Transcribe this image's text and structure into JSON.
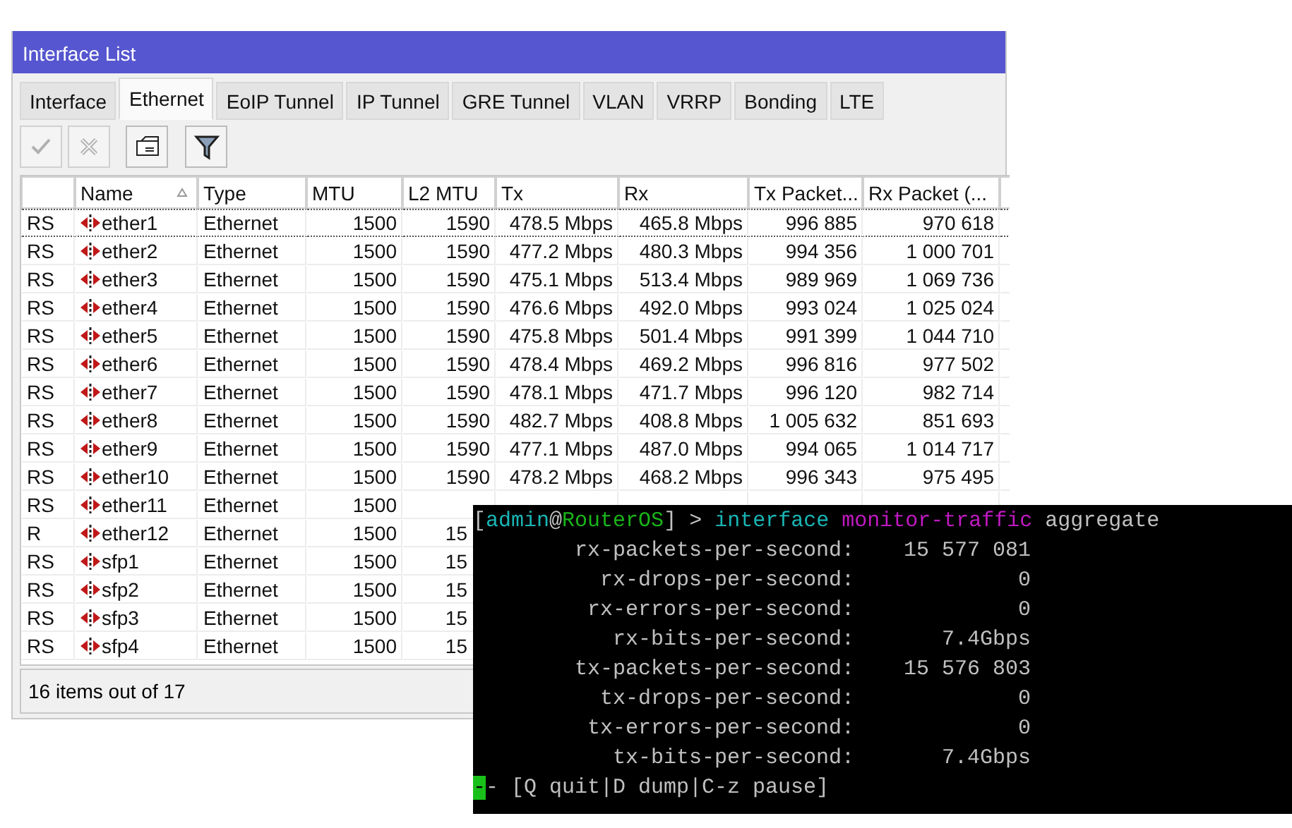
{
  "window": {
    "title": "Interface List"
  },
  "tabs": [
    {
      "label": "Interface",
      "selected": false
    },
    {
      "label": "Ethernet",
      "selected": true
    },
    {
      "label": "EoIP Tunnel",
      "selected": false
    },
    {
      "label": "IP Tunnel",
      "selected": false
    },
    {
      "label": "GRE Tunnel",
      "selected": false
    },
    {
      "label": "VLAN",
      "selected": false
    },
    {
      "label": "VRRP",
      "selected": false
    },
    {
      "label": "Bonding",
      "selected": false
    },
    {
      "label": "LTE",
      "selected": false
    }
  ],
  "toolbar": [
    {
      "kind": "enable",
      "disabled": true
    },
    {
      "kind": "disable",
      "disabled": true
    },
    {
      "kind": "comment",
      "disabled": false
    },
    {
      "kind": "filter",
      "disabled": false
    }
  ],
  "table": {
    "columns": [
      {
        "label": "Name",
        "sorted": true
      },
      {
        "label": "Type",
        "sorted": false
      },
      {
        "label": "MTU",
        "sorted": false
      },
      {
        "label": "L2 MTU",
        "sorted": false
      },
      {
        "label": "Tx",
        "sorted": false
      },
      {
        "label": "Rx",
        "sorted": false
      },
      {
        "label": "Tx Packet...",
        "sorted": false
      },
      {
        "label": "Rx Packet (...",
        "sorted": false
      }
    ],
    "rows": [
      {
        "flags": "RS",
        "selected": true,
        "cells": [
          "ether1",
          "Ethernet",
          "1500",
          "1590",
          "478.5 Mbps",
          "465.8 Mbps",
          "996 885",
          "970 618"
        ]
      },
      {
        "flags": "RS",
        "selected": false,
        "cells": [
          "ether2",
          "Ethernet",
          "1500",
          "1590",
          "477.2 Mbps",
          "480.3 Mbps",
          "994 356",
          "1 000 701"
        ]
      },
      {
        "flags": "RS",
        "selected": false,
        "cells": [
          "ether3",
          "Ethernet",
          "1500",
          "1590",
          "475.1 Mbps",
          "513.4 Mbps",
          "989 969",
          "1 069 736"
        ]
      },
      {
        "flags": "RS",
        "selected": false,
        "cells": [
          "ether4",
          "Ethernet",
          "1500",
          "1590",
          "476.6 Mbps",
          "492.0 Mbps",
          "993 024",
          "1 025 024"
        ]
      },
      {
        "flags": "RS",
        "selected": false,
        "cells": [
          "ether5",
          "Ethernet",
          "1500",
          "1590",
          "475.8 Mbps",
          "501.4 Mbps",
          "991 399",
          "1 044 710"
        ]
      },
      {
        "flags": "RS",
        "selected": false,
        "cells": [
          "ether6",
          "Ethernet",
          "1500",
          "1590",
          "478.4 Mbps",
          "469.2 Mbps",
          "996 816",
          "977 502"
        ]
      },
      {
        "flags": "RS",
        "selected": false,
        "cells": [
          "ether7",
          "Ethernet",
          "1500",
          "1590",
          "478.1 Mbps",
          "471.7 Mbps",
          "996 120",
          "982 714"
        ]
      },
      {
        "flags": "RS",
        "selected": false,
        "cells": [
          "ether8",
          "Ethernet",
          "1500",
          "1590",
          "482.7 Mbps",
          "408.8 Mbps",
          "1 005 632",
          "851 693"
        ]
      },
      {
        "flags": "RS",
        "selected": false,
        "cells": [
          "ether9",
          "Ethernet",
          "1500",
          "1590",
          "477.1 Mbps",
          "487.0 Mbps",
          "994 065",
          "1 014 717"
        ]
      },
      {
        "flags": "RS",
        "selected": false,
        "cells": [
          "ether10",
          "Ethernet",
          "1500",
          "1590",
          "478.2 Mbps",
          "468.2 Mbps",
          "996 343",
          "975 495"
        ]
      },
      {
        "flags": "RS",
        "selected": false,
        "cells": [
          "ether11",
          "Ethernet",
          "1500"
        ]
      },
      {
        "flags": "R",
        "selected": false,
        "cells": [
          "ether12",
          "Ethernet",
          "1500",
          "15"
        ]
      },
      {
        "flags": "RS",
        "selected": false,
        "cells": [
          "sfp1",
          "Ethernet",
          "1500",
          "15"
        ]
      },
      {
        "flags": "RS",
        "selected": false,
        "cells": [
          "sfp2",
          "Ethernet",
          "1500",
          "15"
        ]
      },
      {
        "flags": "RS",
        "selected": false,
        "cells": [
          "sfp3",
          "Ethernet",
          "1500",
          "15"
        ]
      },
      {
        "flags": "RS",
        "selected": false,
        "cells": [
          "sfp4",
          "Ethernet",
          "1500",
          "15"
        ]
      }
    ]
  },
  "status_bar": "16 items out of 17",
  "terminal": {
    "prompt": [
      {
        "text": "[",
        "color": "#c0c0c0"
      },
      {
        "text": "admin",
        "color": "#19b5b5"
      },
      {
        "text": "@",
        "color": "#c0c0c0"
      },
      {
        "text": "RouterOS",
        "color": "#19b519"
      },
      {
        "text": "] >",
        "color": "#c0c0c0"
      },
      {
        "text": "interface",
        "color": "#19b5b5"
      },
      {
        "text": "monitor-traffic",
        "color": "#c019c0"
      },
      {
        "text": "aggregate",
        "color": "#c0c0c0"
      }
    ],
    "lines": [
      {
        "label": "rx-packets-per-second:",
        "value": "15 577 081"
      },
      {
        "label": "rx-drops-per-second:",
        "value": "0"
      },
      {
        "label": "rx-errors-per-second:",
        "value": "0"
      },
      {
        "label": "rx-bits-per-second:",
        "value": "7.4Gbps"
      },
      {
        "label": "tx-packets-per-second:",
        "value": "15 576 803"
      },
      {
        "label": "tx-drops-per-second:",
        "value": "0"
      },
      {
        "label": "tx-errors-per-second:",
        "value": "0"
      },
      {
        "label": "tx-bits-per-second:",
        "value": "7.4Gbps"
      }
    ],
    "cursor": "-",
    "hint": "- [Q quit|D dump|C-z pause]"
  }
}
